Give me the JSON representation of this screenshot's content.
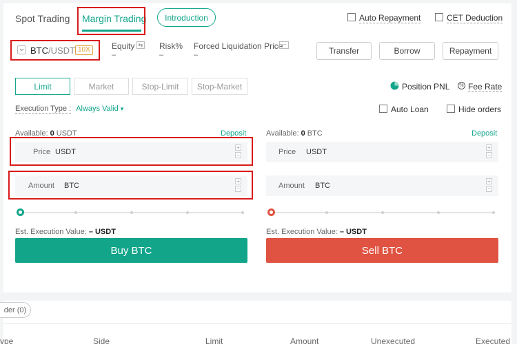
{
  "tabs": {
    "spot": "Spot Trading",
    "margin": "Margin Trading",
    "introduction": "Introduction"
  },
  "options": {
    "auto_repayment": "Auto Repayment",
    "cet_deduction": "CET Deduction"
  },
  "pair": {
    "base": "BTC",
    "quote": "/USDT",
    "leverage": "10X"
  },
  "stats": {
    "equity_label": "Equity",
    "equity_value": "–",
    "risk_label": "Risk%",
    "risk_value": "–",
    "forced_label": "Forced Liquidation Price",
    "forced_value": "–"
  },
  "actions": {
    "transfer": "Transfer",
    "borrow": "Borrow",
    "repayment": "Repayment"
  },
  "order_types": [
    "Limit",
    "Market",
    "Stop-Limit",
    "Stop-Market"
  ],
  "right_tools": {
    "position_pnl": "Position PNL",
    "fee_rate": "Fee Rate",
    "auto_loan": "Auto Loan",
    "hide_orders": "Hide orders"
  },
  "execution": {
    "label": "Execution Type :",
    "value": "Always Valid"
  },
  "buy": {
    "available_label": "Available:",
    "available_value": "0",
    "available_unit": "USDT",
    "deposit": "Deposit",
    "price_label": "Price",
    "price_unit": "USDT",
    "amount_label": "Amount",
    "amount_unit": "BTC",
    "est_label": "Est. Execution Value:",
    "est_value": "– USDT",
    "button": "Buy BTC",
    "color": "#12a58a"
  },
  "sell": {
    "available_label": "Available:",
    "available_value": "0",
    "available_unit": "BTC",
    "deposit": "Deposit",
    "price_label": "Price",
    "price_unit": "USDT",
    "amount_label": "Amount",
    "amount_unit": "BTC",
    "est_label": "Est. Execution Value:",
    "est_value": "– USDT",
    "button": "Sell BTC",
    "color": "#e05342"
  },
  "orders": {
    "tab": "der (0)",
    "columns": [
      "ype",
      "Side",
      "Limit",
      "Amount",
      "Unexecuted",
      "Executed"
    ]
  }
}
